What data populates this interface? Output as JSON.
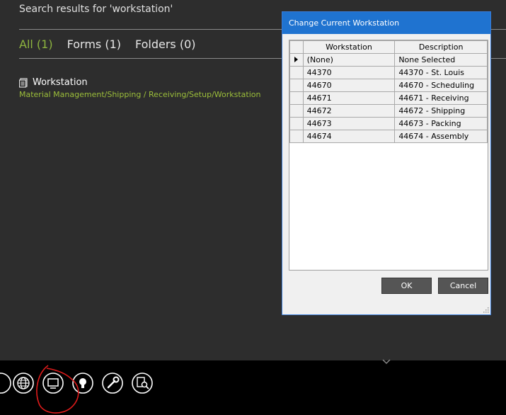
{
  "search": {
    "title": "Search results for 'workstation'",
    "filters": [
      {
        "label": "All (1)",
        "active": true
      },
      {
        "label": "Forms (1)",
        "active": false
      },
      {
        "label": "Folders (0)",
        "active": false
      }
    ],
    "result": {
      "title": "Workstation",
      "path": "Material Management/Shipping / Receiving/Setup/Workstation",
      "icon": "document-icon"
    }
  },
  "dialog": {
    "title": "Change Current Workstation",
    "columns": [
      "Workstation",
      "Description"
    ],
    "rows": [
      {
        "workstation": "(None)",
        "description": "None Selected",
        "current": true
      },
      {
        "workstation": "44370",
        "description": "44370 - St. Louis"
      },
      {
        "workstation": "44670",
        "description": "44670 - Scheduling"
      },
      {
        "workstation": "44671",
        "description": "44671 - Receiving"
      },
      {
        "workstation": "44672",
        "description": "44672 - Shipping"
      },
      {
        "workstation": "44673",
        "description": "44673 - Packing"
      },
      {
        "workstation": "44674",
        "description": "44674 - Assembly"
      }
    ],
    "ok_label": "OK",
    "cancel_label": "Cancel"
  },
  "taskbar": {
    "icons": [
      "globe-icon",
      "monitor-icon",
      "lightbulb-icon",
      "wrench-icon",
      "search-document-icon"
    ]
  }
}
